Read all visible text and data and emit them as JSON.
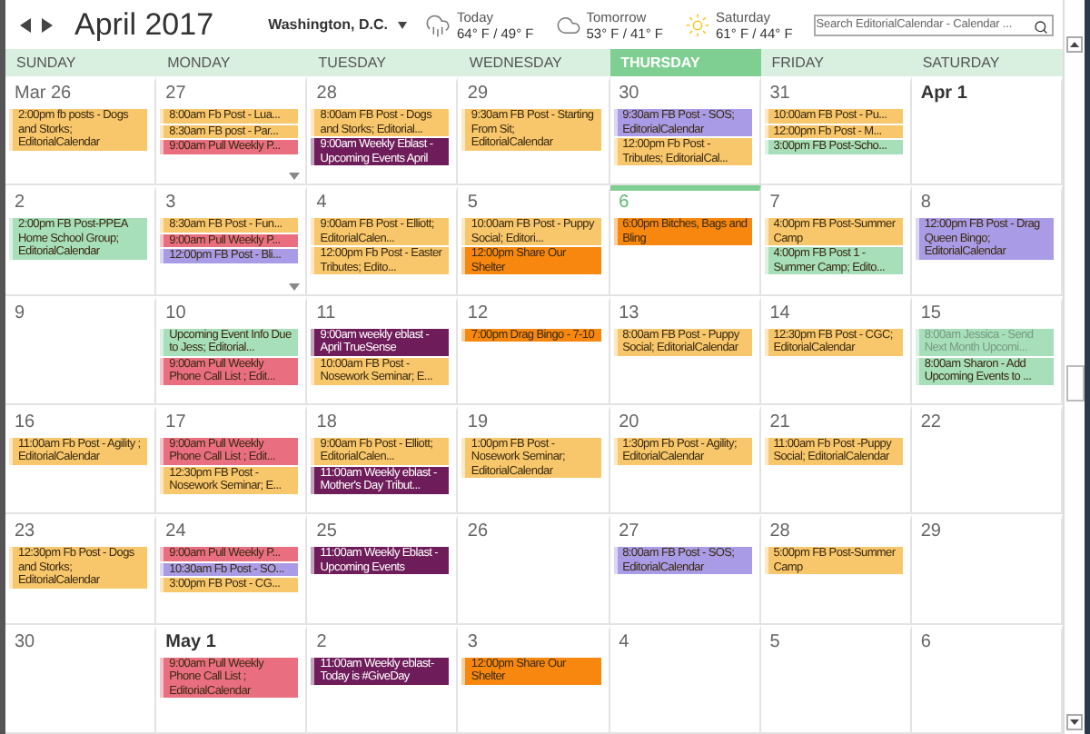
{
  "header": {
    "month": "April 2017",
    "location": "Washington, D.C.",
    "forecast": [
      {
        "kind": "rain",
        "label": "Today",
        "temps": "64° F / 49° F"
      },
      {
        "kind": "cloud",
        "label": "Tomorrow",
        "temps": "53° F / 41° F"
      },
      {
        "kind": "sun",
        "label": "Saturday",
        "temps": "61° F / 44° F"
      }
    ],
    "search": {
      "placeholder": "Search EditorialCalendar - Calendar ..."
    }
  },
  "weekdays": [
    {
      "label": "SUNDAY",
      "selected": false
    },
    {
      "label": "MONDAY",
      "selected": false
    },
    {
      "label": "TUESDAY",
      "selected": false
    },
    {
      "label": "WEDNESDAY",
      "selected": false
    },
    {
      "label": "THURSDAY",
      "selected": true
    },
    {
      "label": "FRIDAY",
      "selected": false
    },
    {
      "label": "SATURDAY",
      "selected": false
    }
  ],
  "weeks": [
    [
      {
        "date": "Mar 26",
        "month_start": false,
        "today": false,
        "more": false,
        "events": [
          {
            "text": "2:00pm fb posts - Dogs and Storks; EditorialCalendar",
            "color": "#f8c76c",
            "tentative": false
          }
        ]
      },
      {
        "date": "27",
        "month_start": false,
        "today": false,
        "more": true,
        "events": [
          {
            "text": "8:00am Fb Post - Lua...",
            "color": "#f8c76c",
            "tentative": false
          },
          {
            "text": "8:30am FB post - Par...",
            "color": "#f8c76c",
            "tentative": false
          },
          {
            "text": "9:00am Pull Weekly P...",
            "color": "#e96f80",
            "tentative": false
          }
        ]
      },
      {
        "date": "28",
        "month_start": false,
        "today": false,
        "more": false,
        "events": [
          {
            "text": "8:00am FB Post - Dogs and Storks; Editorial...",
            "color": "#f8c76c",
            "tentative": false
          },
          {
            "text": "9:00am Weekly Eblast - Upcoming Events April",
            "color": "#6f1d5a",
            "tentative": false
          }
        ]
      },
      {
        "date": "29",
        "month_start": false,
        "today": false,
        "more": false,
        "events": [
          {
            "text": "9:30am FB Post - Starting From Sit; EditorialCalendar",
            "color": "#f8c76c",
            "tentative": false
          }
        ]
      },
      {
        "date": "30",
        "month_start": false,
        "today": false,
        "more": false,
        "events": [
          {
            "text": "9:30am FB Post - SOS; EditorialCalendar",
            "color": "#a99be6",
            "tentative": false
          },
          {
            "text": "12:00pm Fb Post - Tributes; EditorialCal...",
            "color": "#f8c76c",
            "tentative": false
          }
        ]
      },
      {
        "date": "31",
        "month_start": false,
        "today": false,
        "more": false,
        "events": [
          {
            "text": "10:00am FB Post - Pu...",
            "color": "#f8c76c",
            "tentative": false
          },
          {
            "text": "12:00pm Fb Post - M...",
            "color": "#f8c76c",
            "tentative": false
          },
          {
            "text": "3:00pm FB Post-Scho...",
            "color": "#a6dfb9",
            "tentative": false
          }
        ]
      },
      {
        "date": "Apr 1",
        "month_start": true,
        "today": false,
        "more": false
      }
    ],
    [
      {
        "date": "2",
        "month_start": false,
        "today": false,
        "more": false,
        "events": [
          {
            "text": "2:00pm FB Post-PPEA Home School Group; EditorialCalendar",
            "color": "#a6dfb9",
            "tentative": false
          }
        ]
      },
      {
        "date": "3",
        "month_start": false,
        "today": false,
        "more": true,
        "events": [
          {
            "text": "8:30am FB Post - Fun...",
            "color": "#f8c76c",
            "tentative": false
          },
          {
            "text": "9:00am Pull Weekly P...",
            "color": "#e96f80",
            "tentative": false
          },
          {
            "text": "12:00pm FB Post - Bli...",
            "color": "#a99be6",
            "tentative": false
          }
        ]
      },
      {
        "date": "4",
        "month_start": false,
        "today": false,
        "more": false,
        "events": [
          {
            "text": "9:00am FB Post - Elliott; EditorialCalen...",
            "color": "#f8c76c",
            "tentative": false
          },
          {
            "text": "12:00pm Fb Post - Easter Tributes; Edito...",
            "color": "#f8c76c",
            "tentative": false
          }
        ]
      },
      {
        "date": "5",
        "month_start": false,
        "today": false,
        "more": false,
        "events": [
          {
            "text": "10:00am FB Post - Puppy Social; Editori...",
            "color": "#f8c76c",
            "tentative": false
          },
          {
            "text": "12:00pm Share Our Shelter",
            "color": "#f7870f",
            "tentative": false
          }
        ]
      },
      {
        "date": "6",
        "month_start": false,
        "today": true,
        "more": false,
        "events": [
          {
            "text": "6:00pm Bitches, Bags and Bling",
            "color": "#f7870f",
            "tentative": false
          }
        ]
      },
      {
        "date": "7",
        "month_start": false,
        "today": false,
        "more": false,
        "events": [
          {
            "text": "4:00pm FB Post-Summer Camp",
            "color": "#f8c76c",
            "tentative": false
          },
          {
            "text": "4:00pm FB Post 1 - Summer Camp; Edito...",
            "color": "#a6dfb9",
            "tentative": false
          }
        ]
      },
      {
        "date": "8",
        "month_start": false,
        "today": false,
        "more": false,
        "events": [
          {
            "text": "12:00pm FB Post - Drag Queen Bingo; EditorialCalendar",
            "color": "#a99be6",
            "tentative": false
          }
        ]
      }
    ],
    [
      {
        "date": "9",
        "month_start": false,
        "today": false,
        "more": false
      },
      {
        "date": "10",
        "month_start": false,
        "today": false,
        "more": false,
        "events": [
          {
            "text": "Upcoming Event Info Due to Jess; Editorial...",
            "color": "#a6dfb9",
            "tentative": false
          },
          {
            "text": "9:00am Pull Weekly Phone Call List ; Edit...",
            "color": "#e96f80",
            "tentative": false
          }
        ]
      },
      {
        "date": "11",
        "month_start": false,
        "today": false,
        "more": false,
        "events": [
          {
            "text": "9:00am weekly eblast - April TrueSense",
            "color": "#6f1d5a",
            "tentative": false
          },
          {
            "text": "10:00am FB Post - Nosework Seminar; E...",
            "color": "#f8c76c",
            "tentative": false
          }
        ]
      },
      {
        "date": "12",
        "month_start": false,
        "today": false,
        "more": false,
        "events": [
          {
            "text": "7:00pm Drag Bingo - 7-10",
            "color": "#f7870f",
            "tentative": false
          }
        ]
      },
      {
        "date": "13",
        "month_start": false,
        "today": false,
        "more": false,
        "events": [
          {
            "text": "8:00am FB Post - Puppy Social; EditorialCalendar",
            "color": "#f8c76c",
            "tentative": false
          }
        ]
      },
      {
        "date": "14",
        "month_start": false,
        "today": false,
        "more": false,
        "events": [
          {
            "text": "12:30pm FB Post - CGC; EditorialCalendar",
            "color": "#f8c76c",
            "tentative": false
          }
        ]
      },
      {
        "date": "15",
        "month_start": false,
        "today": false,
        "more": false,
        "events": [
          {
            "text": "8:00am Jessica - Send Next Month Upcomi...",
            "color": "#a6dfb9",
            "tentative": true
          },
          {
            "text": "8:00am Sharon - Add Upcoming Events to ...",
            "color": "#a6dfb9",
            "tentative": false
          }
        ]
      }
    ],
    [
      {
        "date": "16",
        "month_start": false,
        "today": false,
        "more": false,
        "events": [
          {
            "text": "11:00am Fb Post - Agility ; EditorialCalendar",
            "color": "#f8c76c",
            "tentative": false
          }
        ]
      },
      {
        "date": "17",
        "month_start": false,
        "today": false,
        "more": false,
        "events": [
          {
            "text": "9:00am Pull Weekly Phone Call List ; Edit...",
            "color": "#e96f80",
            "tentative": false
          },
          {
            "text": "12:30pm FB Post - Nosework Seminar; E...",
            "color": "#f8c76c",
            "tentative": false
          }
        ]
      },
      {
        "date": "18",
        "month_start": false,
        "today": false,
        "more": false,
        "events": [
          {
            "text": "9:00am Fb Post - Elliott; EditorialCalen...",
            "color": "#f8c76c",
            "tentative": false
          },
          {
            "text": "11:00am Weekly eblast - Mother's Day Tribut...",
            "color": "#6f1d5a",
            "tentative": false
          }
        ]
      },
      {
        "date": "19",
        "month_start": false,
        "today": false,
        "more": false,
        "events": [
          {
            "text": "1:00pm FB Post - Nosework Seminar; EditorialCalendar",
            "color": "#f8c76c",
            "tentative": false
          }
        ]
      },
      {
        "date": "20",
        "month_start": false,
        "today": false,
        "more": false,
        "events": [
          {
            "text": "1:30pm Fb Post - Agility; EditorialCalendar",
            "color": "#f8c76c",
            "tentative": false
          }
        ]
      },
      {
        "date": "21",
        "month_start": false,
        "today": false,
        "more": false,
        "events": [
          {
            "text": "11:00am Fb Post -Puppy Social; EditorialCalendar",
            "color": "#f8c76c",
            "tentative": false
          }
        ]
      },
      {
        "date": "22",
        "month_start": false,
        "today": false,
        "more": false
      }
    ],
    [
      {
        "date": "23",
        "month_start": false,
        "today": false,
        "more": false,
        "events": [
          {
            "text": "12:30pm Fb Post - Dogs and Storks; EditorialCalendar",
            "color": "#f8c76c",
            "tentative": false
          }
        ]
      },
      {
        "date": "24",
        "month_start": false,
        "today": false,
        "more": false,
        "events": [
          {
            "text": "9:00am Pull Weekly P...",
            "color": "#e96f80",
            "tentative": false
          },
          {
            "text": "10:30am Fb Post - SO...",
            "color": "#a99be6",
            "tentative": false
          },
          {
            "text": "3:00pm FB Post - CG...",
            "color": "#f8c76c",
            "tentative": false
          }
        ]
      },
      {
        "date": "25",
        "month_start": false,
        "today": false,
        "more": false,
        "events": [
          {
            "text": "11:00am Weekly Eblast - Upcoming Events",
            "color": "#6f1d5a",
            "tentative": false
          }
        ]
      },
      {
        "date": "26",
        "month_start": false,
        "today": false,
        "more": false
      },
      {
        "date": "27",
        "month_start": false,
        "today": false,
        "more": false,
        "events": [
          {
            "text": "8:00am FB Post - SOS; EditorialCalendar",
            "color": "#a99be6",
            "tentative": false
          }
        ]
      },
      {
        "date": "28",
        "month_start": false,
        "today": false,
        "more": false,
        "events": [
          {
            "text": "5:00pm FB Post-Summer Camp",
            "color": "#f8c76c",
            "tentative": false
          }
        ]
      },
      {
        "date": "29",
        "month_start": false,
        "today": false,
        "more": false
      }
    ],
    [
      {
        "date": "30",
        "month_start": false,
        "today": false,
        "more": false
      },
      {
        "date": "May 1",
        "month_start": true,
        "today": false,
        "more": false,
        "events": [
          {
            "text": "9:00am Pull Weekly Phone Call List ; EditorialCalendar",
            "color": "#e96f80",
            "tentative": false
          }
        ]
      },
      {
        "date": "2",
        "month_start": false,
        "today": false,
        "more": false,
        "events": [
          {
            "text": "11:00am Weekly eblast- Today is #GiveDay",
            "color": "#6f1d5a",
            "tentative": false
          }
        ]
      },
      {
        "date": "3",
        "month_start": false,
        "today": false,
        "more": false,
        "events": [
          {
            "text": "12:00pm Share Our Shelter",
            "color": "#f7870f",
            "tentative": false
          }
        ]
      },
      {
        "date": "4",
        "month_start": false,
        "today": false,
        "more": false
      },
      {
        "date": "5",
        "month_start": false,
        "today": false,
        "more": false
      },
      {
        "date": "6",
        "month_start": false,
        "today": false,
        "more": false
      }
    ]
  ]
}
